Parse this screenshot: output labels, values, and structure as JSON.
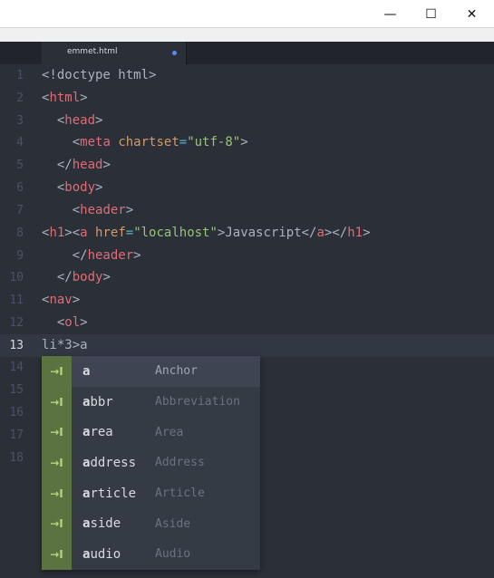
{
  "window": {
    "minimize_glyph": "—",
    "maximize_glyph": "☐",
    "close_glyph": "✕"
  },
  "tab": {
    "title": "emmet.html"
  },
  "editor": {
    "line_numbers": [
      "1",
      "2",
      "3",
      "4",
      "5",
      "6",
      "7",
      "8",
      "9",
      "10",
      "11",
      "12",
      "13",
      "14",
      "15",
      "16",
      "17",
      "18"
    ],
    "active_line": "13",
    "current_input": "li*3>a"
  },
  "autocomplete": {
    "items": [
      {
        "icon": "→I",
        "match": "a",
        "rest": "",
        "desc": "Anchor"
      },
      {
        "icon": "→I",
        "match": "a",
        "rest": "bbr",
        "desc": "Abbreviation"
      },
      {
        "icon": "→I",
        "match": "a",
        "rest": "rea",
        "desc": "Area"
      },
      {
        "icon": "→I",
        "match": "a",
        "rest": "ddress",
        "desc": "Address"
      },
      {
        "icon": "→I",
        "match": "a",
        "rest": "rticle",
        "desc": "Article"
      },
      {
        "icon": "→I",
        "match": "a",
        "rest": "side",
        "desc": "Aside"
      },
      {
        "icon": "→I",
        "match": "a",
        "rest": "udio",
        "desc": "Audio"
      }
    ],
    "selected_index": 0
  },
  "colors": {
    "background": "#2b2f37",
    "tag": "#e06c75",
    "attribute": "#d19a66",
    "string": "#98c379",
    "snippet_icon_bg": "#5b7340"
  }
}
